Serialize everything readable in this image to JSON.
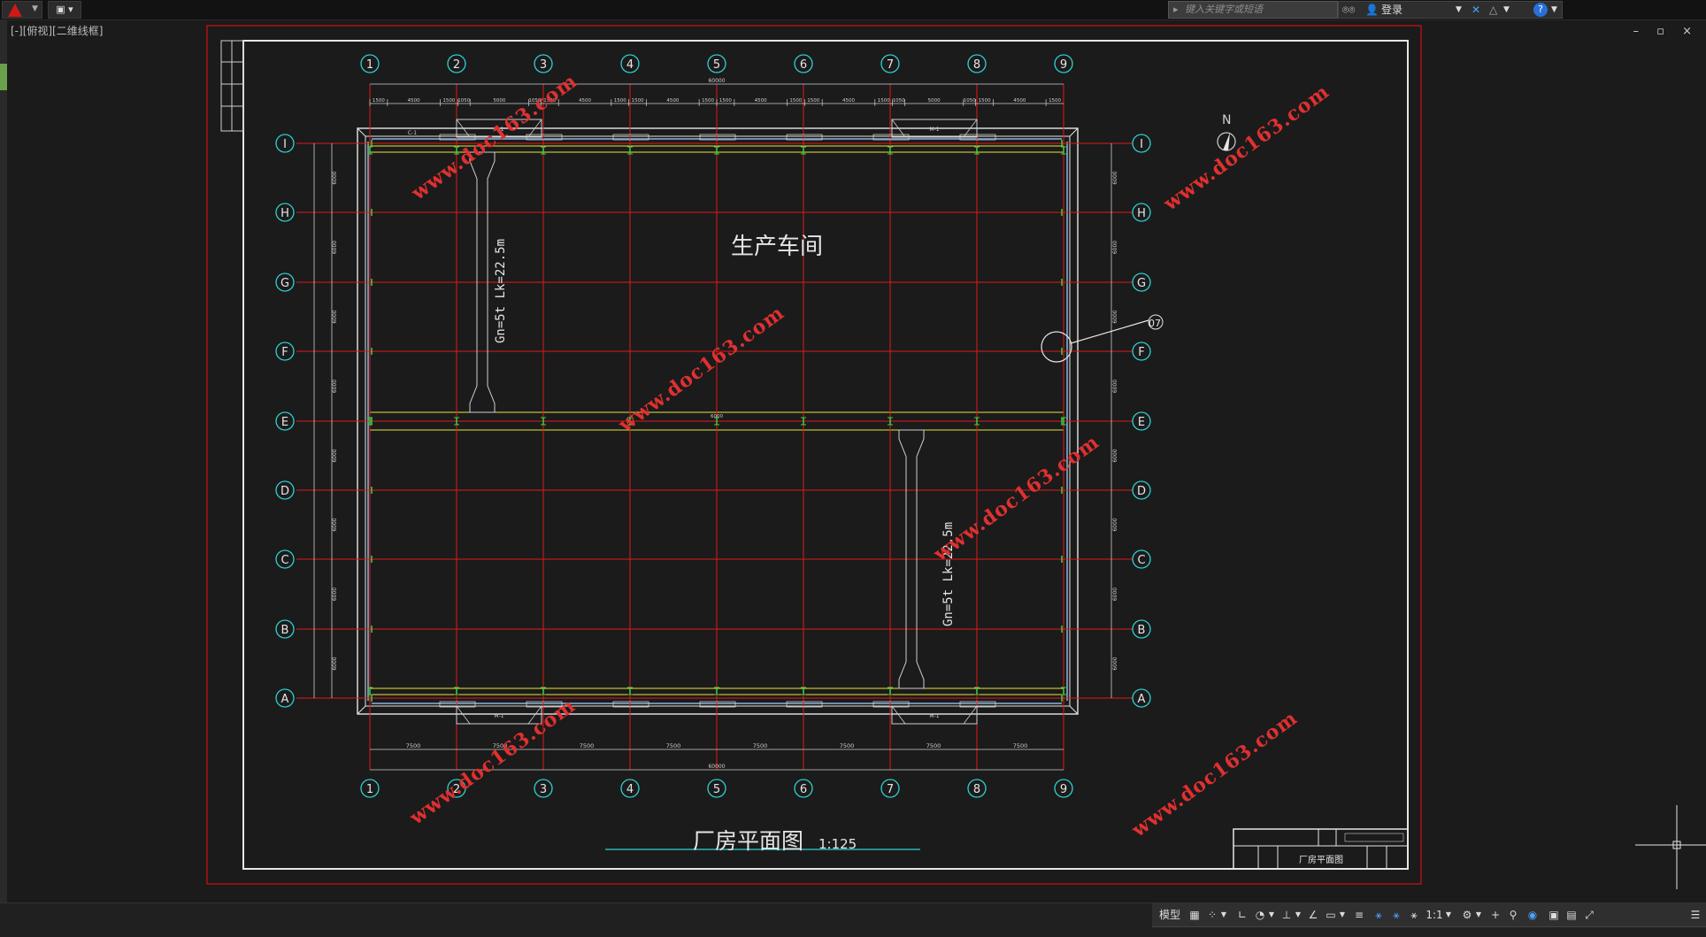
{
  "titlebar": {
    "qa_save_label": "▣ ▾",
    "search_placeholder": "键入关键字或短语",
    "login_label": "登录",
    "help_label": "?"
  },
  "window_controls": "– ▫ ×",
  "viewport_label": "[-][俯视][二维线框]",
  "drawing": {
    "column_axes": [
      "1",
      "2",
      "3",
      "4",
      "5",
      "6",
      "7",
      "8",
      "9"
    ],
    "row_axes": [
      "I",
      "H",
      "G",
      "F",
      "E",
      "D",
      "C",
      "B",
      "A"
    ],
    "workshop_label": "生产车间",
    "crane_label": "Gn=5t  Lk=22.5m",
    "crane_label_2": "Gn=5t  Lk=22.5m",
    "north_label": "N",
    "door_label": "M-1",
    "window_label": "C-1",
    "total_dim": "60000",
    "bay_dim": "7500",
    "mid_dim": "6000",
    "plan_title": "厂房平面图",
    "plan_scale": "1:125",
    "titleblock_name": "厂房平面图",
    "detail_mark": "07",
    "top_dims": [
      "1500",
      "4500",
      "1500",
      "1050",
      "5000",
      "1050",
      "1500",
      "4500",
      "1500",
      "1500",
      "4500",
      "1500",
      "1500",
      "4500",
      "1500",
      "1500",
      "4500",
      "1500",
      "1050",
      "5000",
      "1050",
      "1500",
      "4500",
      "1500"
    ],
    "bottom_dims": [
      "7500",
      "7500",
      "7500",
      "7500",
      "7500",
      "7500",
      "7500",
      "7500"
    ],
    "side_dims": [
      "6000",
      "6000",
      "6000",
      "6000",
      "6000",
      "6000",
      "6000",
      "6000"
    ]
  },
  "watermarks": [
    "www.doc163.com",
    "www.doc163.com",
    "www.doc163.com",
    "www.doc163.com",
    "www.doc163.com",
    "www.doc163.com"
  ],
  "statusbar": {
    "model_label": "模型",
    "scale_label": "1:1"
  },
  "colors": {
    "axis_red": "#e01818",
    "wall_white": "#e6e6e6",
    "beam_yellow": "#e6e63c",
    "bubble_cyan": "#2fd2d2",
    "column_green": "#3cd23c",
    "frame_red": "#d01010"
  }
}
